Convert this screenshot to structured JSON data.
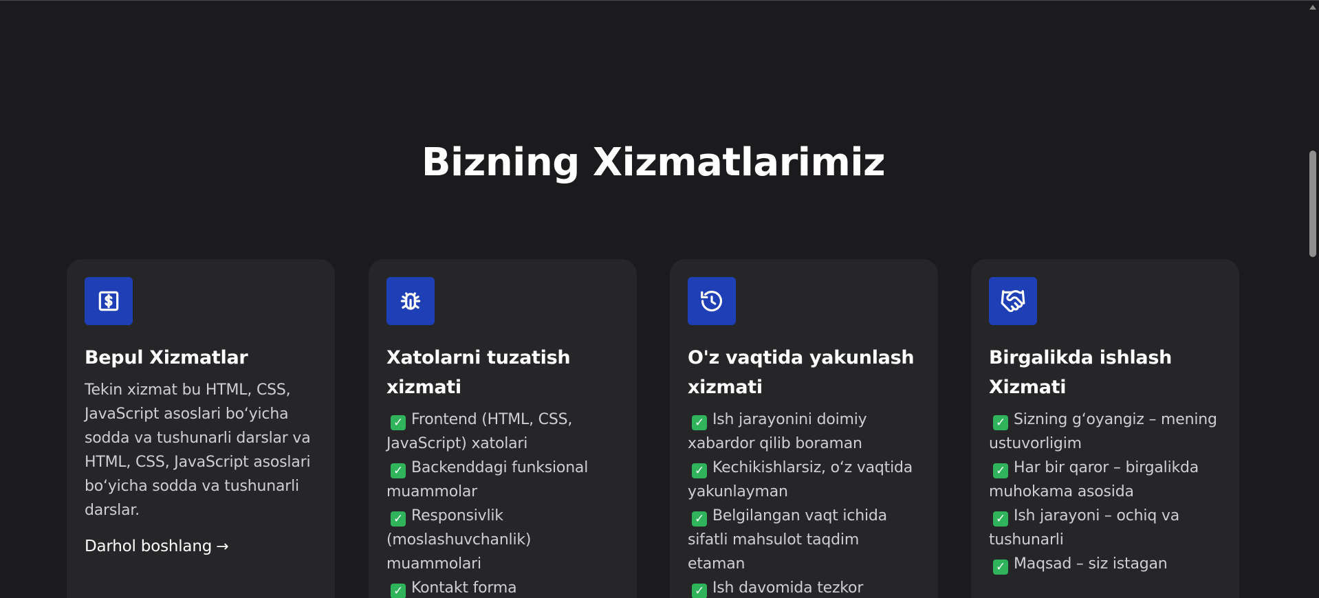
{
  "section": {
    "title": "Bizning Xizmatlarimiz"
  },
  "colors": {
    "background": "#1b1b1d",
    "card": "#262628",
    "icon_bg": "#1f3fb6",
    "check": "#2fb45b"
  },
  "cards": [
    {
      "icon": "dollar-bill-icon",
      "title": "Bepul Xizmatlar",
      "description": "Tekin xizmat bu HTML, CSS, JavaScript asoslari bo‘yicha sodda va tushunarli darslar va HTML, CSS, JavaScript asoslari bo‘yicha sodda va tushunarli darslar.",
      "link": "Darhol boshlang"
    },
    {
      "icon": "bug-icon",
      "title": "Xatolarni tuzatish xizmati",
      "items": [
        "Frontend (HTML, CSS, JavaScript) xatolari",
        "Backenddagi funksional muammolar",
        "Responsivlik (moslashuvchanlik) muammolari",
        "Kontakt forma"
      ]
    },
    {
      "icon": "history-clock-icon",
      "title": "O'z vaqtida yakunlash xizmati",
      "items": [
        "Ish jarayonini doimiy xabardor qilib boraman",
        "Kechikishlarsiz, o‘z vaqtida yakunlayman",
        "Belgilangan vaqt ichida sifatli mahsulot taqdim etaman",
        "Ish davomida tezkor"
      ]
    },
    {
      "icon": "handshake-icon",
      "title": "Birgalikda ishlash Xizmati",
      "items": [
        "Sizning g‘oyangiz – mening ustuvorligim",
        "Har bir qaror – birgalikda muhokama asosida",
        "Ish jarayoni – ochiq va tushunarli",
        "Maqsad – siz istagan"
      ]
    }
  ]
}
